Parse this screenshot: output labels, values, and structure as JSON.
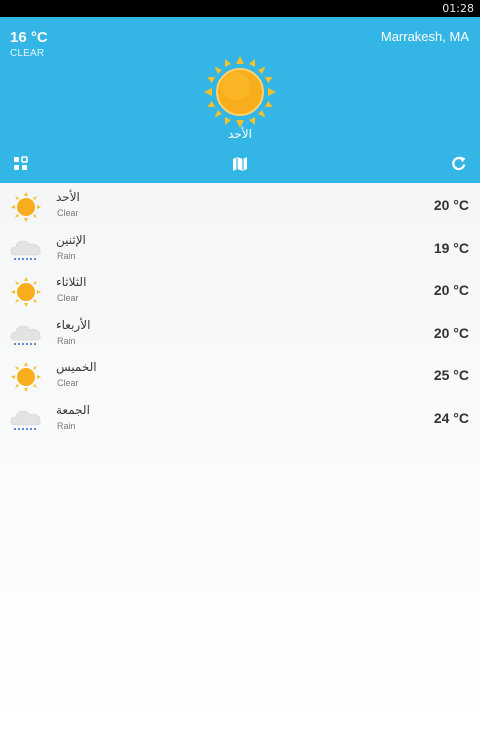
{
  "status_bar": {
    "time": "01:28"
  },
  "current": {
    "temperature": "16 °C",
    "condition": "CLEAR",
    "location": "Marrakesh, MA",
    "day": "الأحد",
    "icon": "sun-icon"
  },
  "toolbar": {
    "left_icon": "grid-icon",
    "center_icon": "map-icon",
    "right_icon": "refresh-icon"
  },
  "forecast": [
    {
      "day": "الأحد",
      "condition": "Clear",
      "temperature": "20 °C",
      "icon": "sun-icon"
    },
    {
      "day": "الإثنين",
      "condition": "Rain",
      "temperature": "19 °C",
      "icon": "rain-cloud-icon"
    },
    {
      "day": "الثلاثاء",
      "condition": "Clear",
      "temperature": "20 °C",
      "icon": "sun-icon"
    },
    {
      "day": "الأربعاء",
      "condition": "Rain",
      "temperature": "20 °C",
      "icon": "rain-cloud-icon"
    },
    {
      "day": "الخميس",
      "condition": "Clear",
      "temperature": "25 °C",
      "icon": "sun-icon"
    },
    {
      "day": "الجمعة",
      "condition": "Rain",
      "temperature": "24 °C",
      "icon": "rain-cloud-icon"
    }
  ],
  "colors": {
    "header": "#33b5e5",
    "sun": "#f8ad1c",
    "sun_rays": "#f5c02a",
    "cloud": "#e3e3e3",
    "rain": "#4e7fd6"
  }
}
